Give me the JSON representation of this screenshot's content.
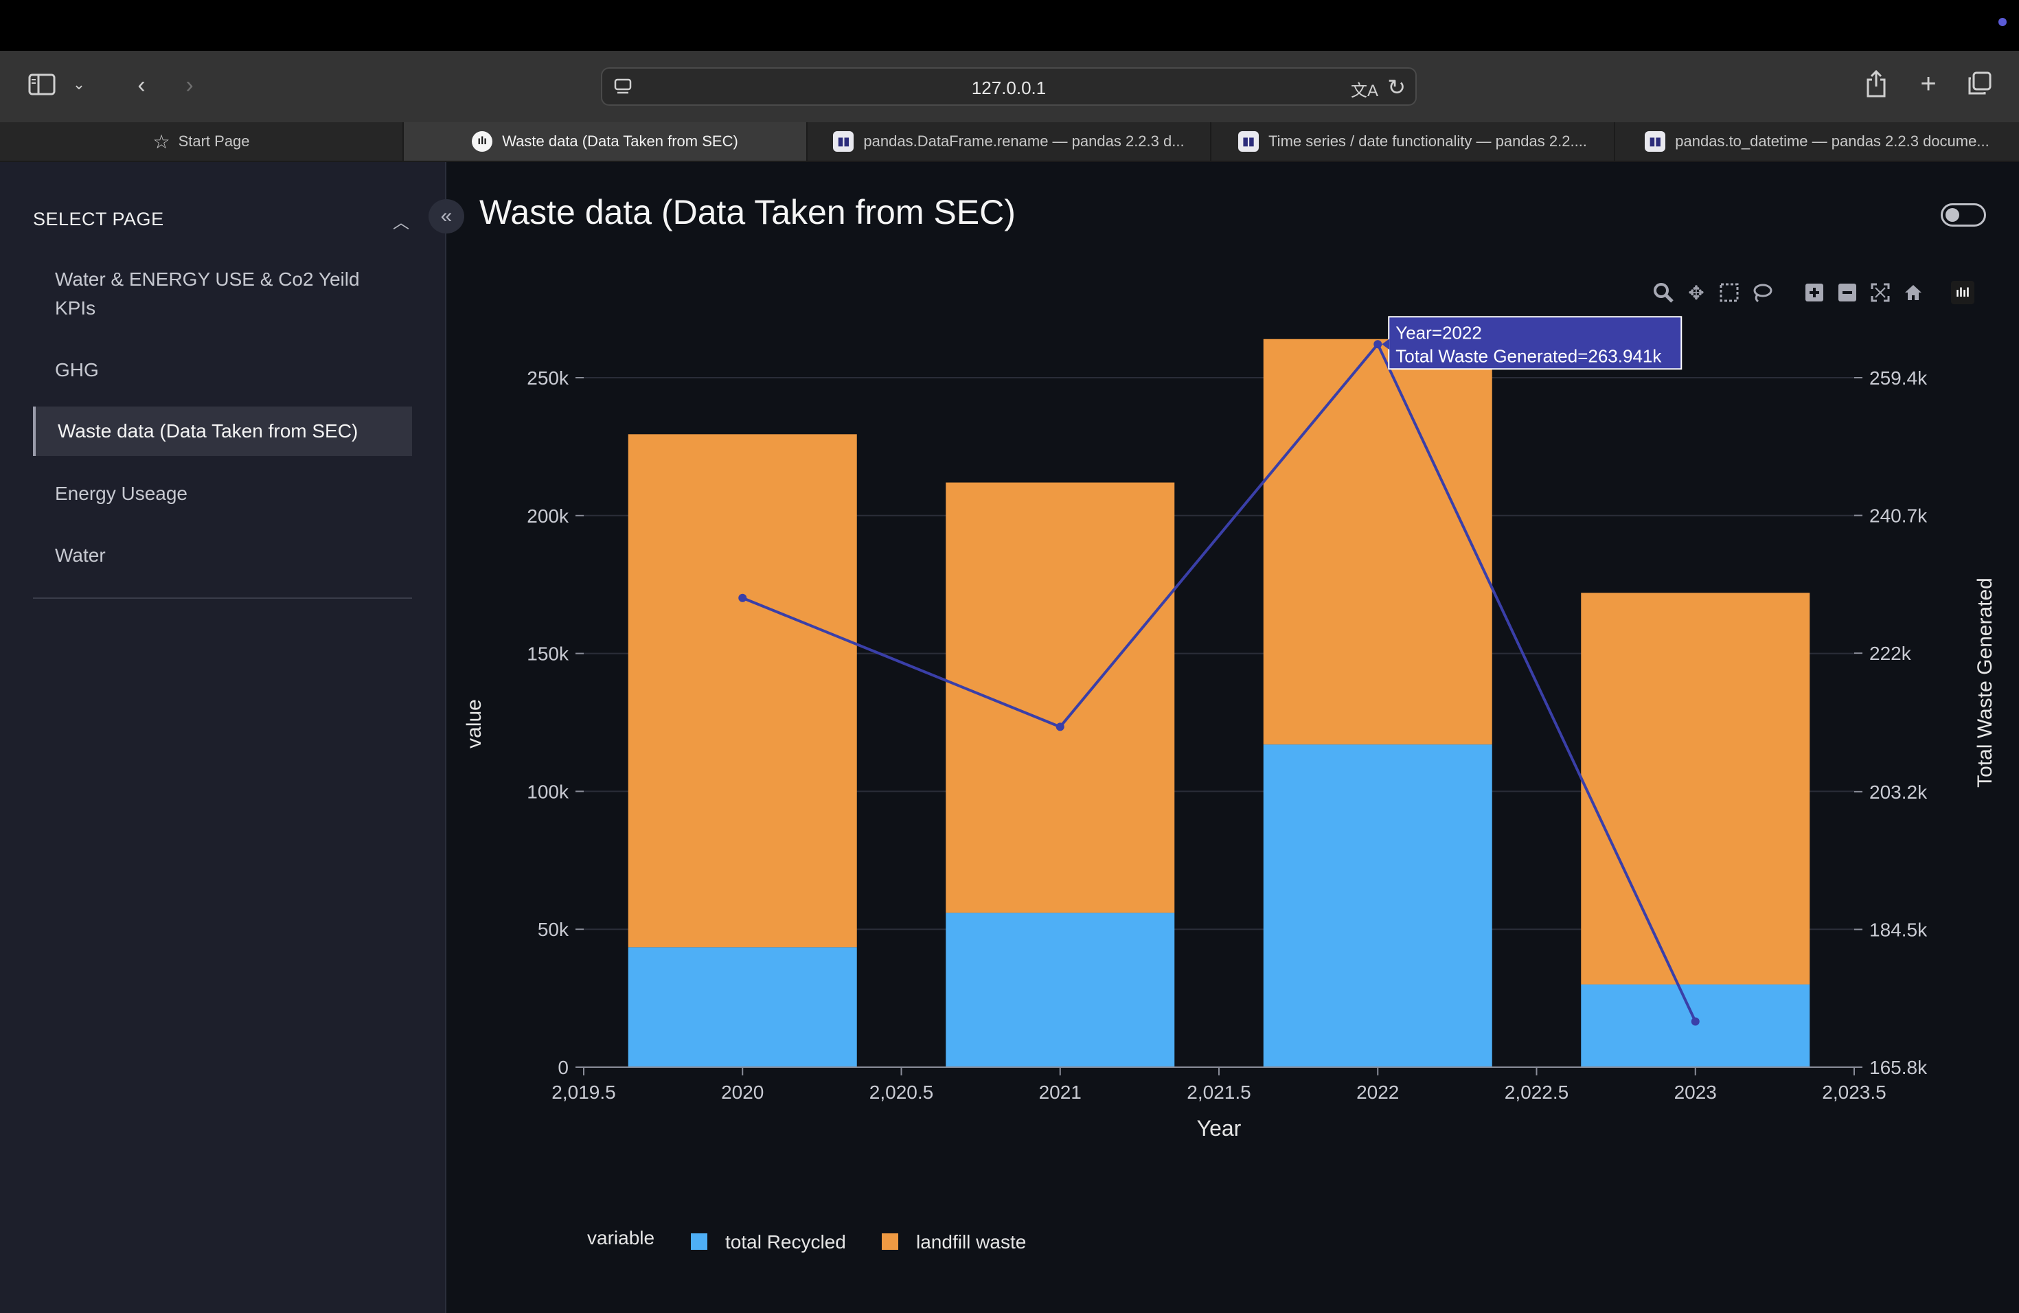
{
  "browser": {
    "url": "127.0.0.1",
    "tabs": [
      {
        "label": "Start Page",
        "icon": "star-icon",
        "active": false
      },
      {
        "label": "Waste data (Data Taken from SEC)",
        "icon": "plotly-favicon",
        "active": true
      },
      {
        "label": "pandas.DataFrame.rename — pandas 2.2.3 d...",
        "icon": "pandas-favicon",
        "active": false
      },
      {
        "label": "Time series / date functionality — pandas 2.2....",
        "icon": "pandas-favicon",
        "active": false
      },
      {
        "label": "pandas.to_datetime — pandas 2.2.3 docume...",
        "icon": "pandas-favicon",
        "active": false
      }
    ]
  },
  "sidebar": {
    "header": "SELECT PAGE",
    "items": [
      {
        "label": "Water & ENERGY USE & Co2 Yeild KPIs",
        "active": false
      },
      {
        "label": "GHG",
        "active": false
      },
      {
        "label": "Waste data (Data Taken from SEC)",
        "active": true
      },
      {
        "label": "Energy Useage",
        "active": false
      },
      {
        "label": "Water",
        "active": false
      }
    ]
  },
  "page": {
    "title": "Waste data (Data Taken from SEC)",
    "theme_toggle_on": false
  },
  "colors": {
    "recycled": "#4eaff6",
    "landfill": "#ef9a43",
    "line": "#3a3fa8",
    "tooltip_bg": "#3b3fa6",
    "background": "#0e1117",
    "sidebar": "#1d1f2b"
  },
  "chart_data": {
    "type": "bar",
    "barmode": "stack",
    "x": [
      2020,
      2021,
      2022,
      2023
    ],
    "xlabel": "Year",
    "ylabel": "value",
    "y2label": "Total Waste Generated",
    "xticks": [
      "2,019.5",
      "2020",
      "2,020.5",
      "2021",
      "2,021.5",
      "2022",
      "2,022.5",
      "2023",
      "2,023.5"
    ],
    "xtick_values": [
      2019.5,
      2020,
      2020.5,
      2021,
      2021.5,
      2022,
      2022.5,
      2023,
      2023.5
    ],
    "xlim": [
      2019.5,
      2023.5
    ],
    "yticks": [
      "0",
      "50k",
      "100k",
      "150k",
      "200k",
      "250k"
    ],
    "ytick_values": [
      0,
      50000,
      100000,
      150000,
      200000,
      250000
    ],
    "ylim": [
      0,
      263941
    ],
    "y2ticks": [
      "165.8k",
      "184.5k",
      "203.2k",
      "222k",
      "240.7k",
      "259.4k"
    ],
    "y2tick_values": [
      165800,
      184500,
      203200,
      222000,
      240700,
      259400
    ],
    "y2lim": [
      165800,
      259400
    ],
    "series": [
      {
        "name": "total Recycled",
        "kind": "bar",
        "values": [
          43500,
          56000,
          117000,
          30000
        ]
      },
      {
        "name": "landfill waste",
        "kind": "bar",
        "values": [
          186000,
          156000,
          147000,
          142000
        ]
      },
      {
        "name": "Total Waste Generated",
        "kind": "line",
        "axis": "y2",
        "values": [
          229500,
          212000,
          263941,
          172000
        ]
      }
    ],
    "legend": {
      "title": "variable",
      "position": "bottom-left"
    },
    "grid": true,
    "tooltip": {
      "line1": "Year=2022",
      "line2": "Total Waste Generated=263.941k"
    }
  }
}
